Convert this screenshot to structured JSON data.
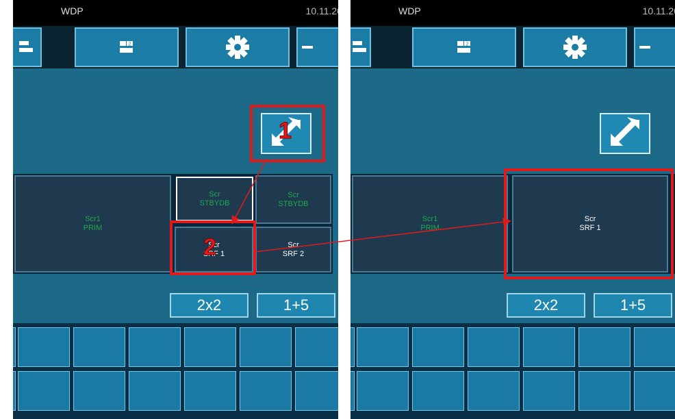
{
  "left_screen": {
    "status": {
      "title": "WDP",
      "date": "10.11.20"
    },
    "toolbar": [
      {
        "icon": "layout-1-icon"
      },
      {
        "icon": "layout-2-icon",
        "badge": "2"
      },
      {
        "icon": "gear-icon"
      },
      {
        "icon": "arrow-icon"
      }
    ],
    "cells": {
      "prim": {
        "line1": "Scr1",
        "line2": "PRIM"
      },
      "stbydb1": {
        "line1": "Scr",
        "line2": "STBYDB"
      },
      "stbydb2": {
        "line1": "Scr",
        "line2": "STBYDB"
      },
      "srf1": {
        "line1": "Scr",
        "line2": "SRF 1"
      },
      "srf2": {
        "line1": "Scr",
        "line2": "SRF 2"
      }
    },
    "layout_buttons": {
      "b2x2": "2x2",
      "b1p5": "1+5"
    },
    "step_labels": {
      "s1": "1",
      "s2": "2"
    }
  },
  "right_screen": {
    "status": {
      "title": "WDP",
      "date": "10.11.20"
    },
    "cells": {
      "prim": {
        "line1": "Scr1",
        "line2": "PRIM"
      },
      "srf1": {
        "line1": "Scr",
        "line2": "SRF 1"
      }
    },
    "layout_buttons": {
      "b2x2": "2x2",
      "b1p5": "1+5"
    }
  },
  "colors": {
    "highlight": "#e01b1b",
    "green_text": "#1fa84a",
    "button_blue": "#1b7ca6"
  }
}
